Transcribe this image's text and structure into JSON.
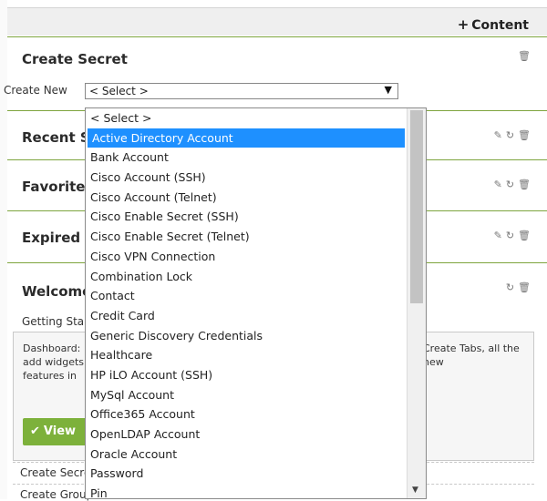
{
  "header": {
    "add_content_label": "Content"
  },
  "create_secret": {
    "title": "Create Secret",
    "create_new_label": "Create New",
    "select_value": "< Select >"
  },
  "panels": {
    "recent": "Recent Secrets",
    "favorites": "Favorite Secrets",
    "expired": "Expired Secrets",
    "welcome": "Welcome"
  },
  "welcome": {
    "getting_started": "Getting Started",
    "dash_text_left": "Dashboard: add widgets features in",
    "dash_text_right": "Create Tabs, all the new",
    "view_button": "View"
  },
  "links": {
    "create_secret": "Create Secret",
    "create_group": "Create Group"
  },
  "dropdown": {
    "options": [
      "< Select >",
      "Active Directory Account",
      "Bank Account",
      "Cisco Account (SSH)",
      "Cisco Account (Telnet)",
      "Cisco Enable Secret (SSH)",
      "Cisco Enable Secret (Telnet)",
      "Cisco VPN Connection",
      "Combination Lock",
      "Contact",
      "Credit Card",
      "Generic Discovery Credentials",
      "Healthcare",
      "HP iLO Account (SSH)",
      "MySql Account",
      "Office365 Account",
      "OpenLDAP Account",
      "Oracle Account",
      "Password",
      "Pin"
    ],
    "selected_index": 1
  },
  "colors": {
    "accent_green": "#7db13b",
    "selection_blue": "#1e90ff"
  }
}
